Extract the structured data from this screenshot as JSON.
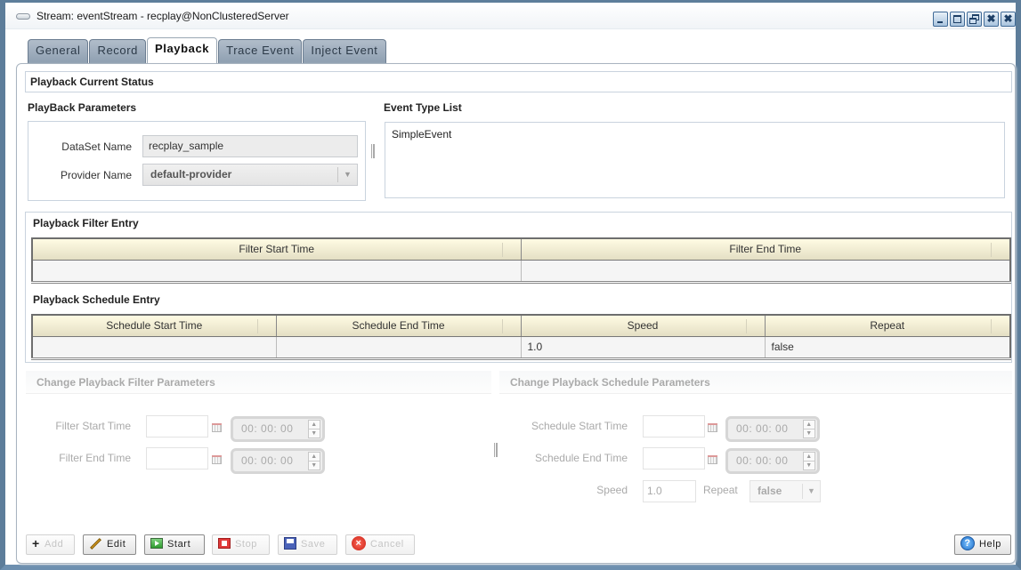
{
  "window": {
    "title": "Stream: eventStream - recplay@NonClusteredServer",
    "controls": [
      {
        "name": "minimize",
        "glyph": "minimize-icon"
      },
      {
        "name": "maximize",
        "glyph": "maximize-icon"
      },
      {
        "name": "restore",
        "glyph": "restore-icon"
      },
      {
        "name": "detach",
        "glyph": "detach-close-icon"
      },
      {
        "name": "close",
        "glyph": "close-icon"
      }
    ]
  },
  "tabs": [
    {
      "label": "General",
      "active": false
    },
    {
      "label": "Record",
      "active": false
    },
    {
      "label": "Playback",
      "active": true
    },
    {
      "label": "Trace Event",
      "active": false
    },
    {
      "label": "Inject Event",
      "active": false
    }
  ],
  "status": {
    "title": "Playback Current Status"
  },
  "playback_params": {
    "title": "PlayBack Parameters",
    "dataset_label": "DataSet Name",
    "dataset_value": "recplay_sample",
    "provider_label": "Provider Name",
    "provider_value": "default-provider"
  },
  "event_type_list": {
    "title": "Event Type List",
    "items": [
      "SimpleEvent"
    ]
  },
  "filter_entry": {
    "title": "Playback Filter Entry",
    "columns": [
      "Filter Start Time",
      "Filter End Time"
    ],
    "rows": [
      [
        "",
        ""
      ]
    ]
  },
  "schedule_entry": {
    "title": "Playback Schedule Entry",
    "columns": [
      "Schedule Start Time",
      "Schedule End Time",
      "Speed",
      "Repeat"
    ],
    "rows": [
      [
        "",
        "",
        "1.0",
        "false"
      ]
    ]
  },
  "change_filter": {
    "title": "Change Playback Filter Parameters",
    "start_label": "Filter Start Time",
    "start_date": "",
    "start_time": "00: 00: 00",
    "end_label": "Filter End Time",
    "end_date": "",
    "end_time": "00: 00: 00"
  },
  "change_schedule": {
    "title": "Change Playback Schedule Parameters",
    "start_label": "Schedule Start Time",
    "start_date": "",
    "start_time": "00: 00: 00",
    "end_label": "Schedule End Time",
    "end_date": "",
    "end_time": "00: 00: 00",
    "speed_label": "Speed",
    "speed_value": "1.0",
    "repeat_label": "Repeat",
    "repeat_value": "false"
  },
  "buttons": {
    "add": {
      "label": "Add",
      "enabled": false
    },
    "edit": {
      "label": "Edit",
      "enabled": true
    },
    "start": {
      "label": "Start",
      "enabled": true
    },
    "stop": {
      "label": "Stop",
      "enabled": false
    },
    "save": {
      "label": "Save",
      "enabled": false
    },
    "cancel": {
      "label": "Cancel",
      "enabled": false
    },
    "help": {
      "label": "Help",
      "enabled": true
    }
  },
  "icons": {
    "spin_up": "▲",
    "spin_down": "▼",
    "dropdown": "▼",
    "plus": "+",
    "cancel_x": "×",
    "help_q": "?",
    "close_x": "✖"
  }
}
